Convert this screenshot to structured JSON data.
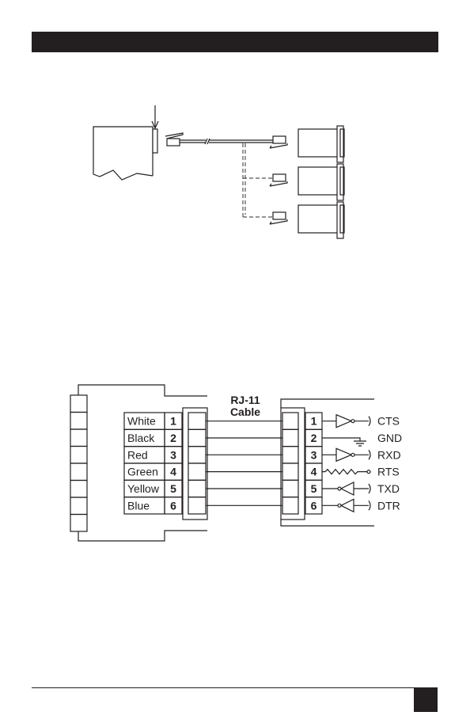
{
  "colors": {
    "ink": "#231f20",
    "background": "#ffffff",
    "dashed_cable": "#555555"
  },
  "header_bar": {
    "text": ""
  },
  "wiring": {
    "cable_label_line1": "RJ-11",
    "cable_label_line2": "Cable",
    "wires": [
      {
        "color": "White",
        "pin": "1",
        "right_pin": "1",
        "signal": "CTS",
        "element": "inverter-in"
      },
      {
        "color": "Black",
        "pin": "2",
        "right_pin": "2",
        "signal": "GND",
        "element": "ground"
      },
      {
        "color": "Red",
        "pin": "3",
        "right_pin": "3",
        "signal": "RXD",
        "element": "inverter-in"
      },
      {
        "color": "Green",
        "pin": "4",
        "right_pin": "4",
        "signal": "RTS",
        "element": "resistor"
      },
      {
        "color": "Yellow",
        "pin": "5",
        "right_pin": "5",
        "signal": "TXD",
        "element": "inverter-out"
      },
      {
        "color": "Blue",
        "pin": "6",
        "right_pin": "6",
        "signal": "DTR",
        "element": "inverter-out"
      }
    ]
  },
  "page_number": ""
}
